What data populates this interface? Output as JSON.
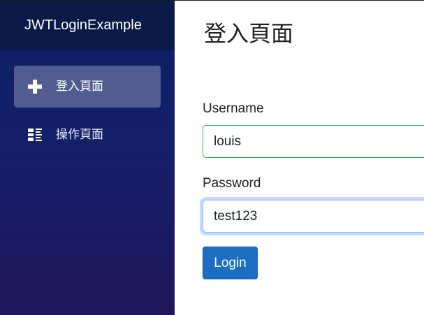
{
  "app": {
    "brand": "JWTLoginExample"
  },
  "sidebar": {
    "items": [
      {
        "label": "登入頁面",
        "icon": "plus-icon",
        "active": true
      },
      {
        "label": "操作頁面",
        "icon": "list-rich-icon",
        "active": false
      }
    ]
  },
  "main": {
    "title": "登入頁面",
    "username": {
      "label": "Username",
      "value": "louis"
    },
    "password": {
      "label": "Password",
      "value": "test123"
    },
    "login_label": "Login"
  },
  "colors": {
    "brand_bar": "#081a45",
    "sidebar_top": "#0c2064",
    "sidebar_bottom": "#21165a",
    "primary_button": "#1b6ec2",
    "valid_border": "#26b050",
    "focus_border": "#86b7fe"
  }
}
